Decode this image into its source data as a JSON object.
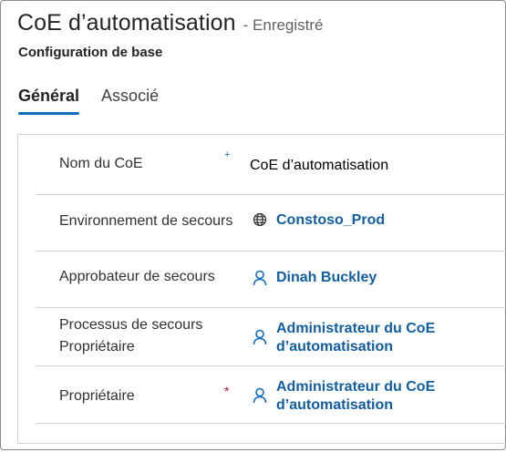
{
  "header": {
    "title": "CoE d’automatisation",
    "status": "- Enregistré",
    "subtitle": "Configuration de base"
  },
  "tabs": [
    {
      "label": "Général",
      "active": true
    },
    {
      "label": "Associé",
      "active": false
    }
  ],
  "fields": [
    {
      "label": "Nom du CoE",
      "required_marker": "+",
      "value": "CoE d’automatisation"
    },
    {
      "label": "Environnement de secours",
      "icon": "globe-icon",
      "value": "Constoso_Prod"
    },
    {
      "label": "Approbateur de secours",
      "icon": "person-icon",
      "value": "Dinah Buckley"
    },
    {
      "label": "Processus de secours Propriétaire",
      "icon": "person-icon",
      "value": "Administrateur du CoE d’automatisation"
    },
    {
      "label": "Propriétaire",
      "required_marker": "*",
      "icon": "person-icon",
      "value": "Administrateur du CoE d’automatisation"
    }
  ],
  "colors": {
    "accent": "#0f6cbd",
    "link": "#115ea3",
    "required": "#c50f1f",
    "recommended": "#0f6cbd"
  }
}
